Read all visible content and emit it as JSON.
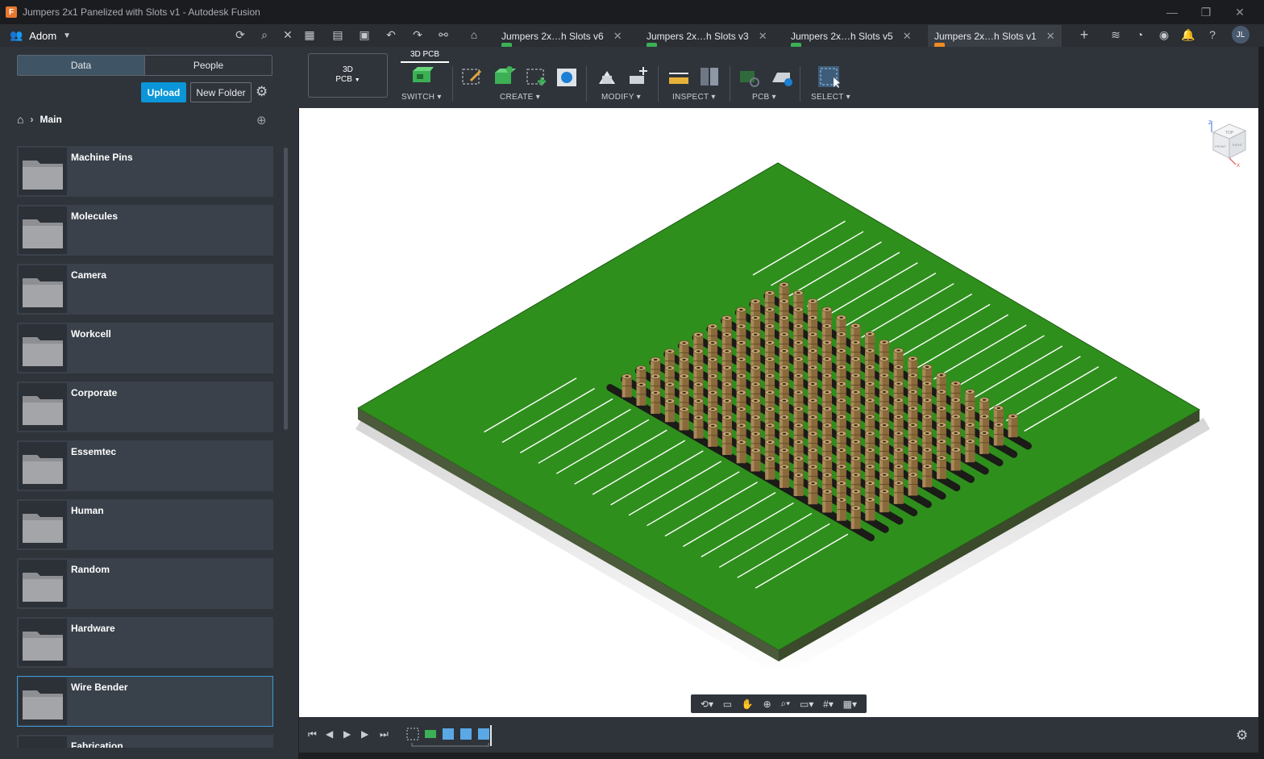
{
  "window": {
    "title": "Jumpers 2x1 Panelized with Slots v1 - Autodesk Fusion"
  },
  "appbar": {
    "team_name": "Adom",
    "tabs": [
      {
        "label": "Jumpers 2x…h Slots v6",
        "icon_color": "#3cb054",
        "active": false
      },
      {
        "label": "Jumpers 2x…h Slots v3",
        "icon_color": "#3cb054",
        "active": false
      },
      {
        "label": "Jumpers 2x…h Slots v5",
        "icon_color": "#3cb054",
        "active": false
      },
      {
        "label": "Jumpers 2x…h Slots v1",
        "icon_color": "#f08a24",
        "active": true
      }
    ],
    "user_initials": "JL"
  },
  "data_panel": {
    "segments": [
      "Data",
      "People"
    ],
    "upload_label": "Upload",
    "new_folder_label": "New Folder",
    "breadcrumb": "Main",
    "folders": [
      "Machine Pins",
      "Molecules",
      "Camera",
      "Workcell",
      "Corporate",
      "Essemtec",
      "Human",
      "Random",
      "Hardware",
      "Wire Bender",
      "Fabrication"
    ],
    "selected_folder": "Wire Bender"
  },
  "toolbar": {
    "workspace_line1": "3D",
    "workspace_line2": "PCB",
    "workspace_tab": "3D PCB",
    "groups": [
      "SWITCH",
      "CREATE",
      "MODIFY",
      "INSPECT",
      "PCB",
      "SELECT"
    ]
  },
  "viewcube": {
    "top": "TOP",
    "front": "FRONT",
    "right": "RIGHT",
    "axis_z": "Z",
    "axis_x": "X"
  },
  "colors": {
    "board": "#2f8f1c",
    "board_edge": "#3a4a2a",
    "pins": "#8a6a3a",
    "accent": "#0a96d8"
  }
}
